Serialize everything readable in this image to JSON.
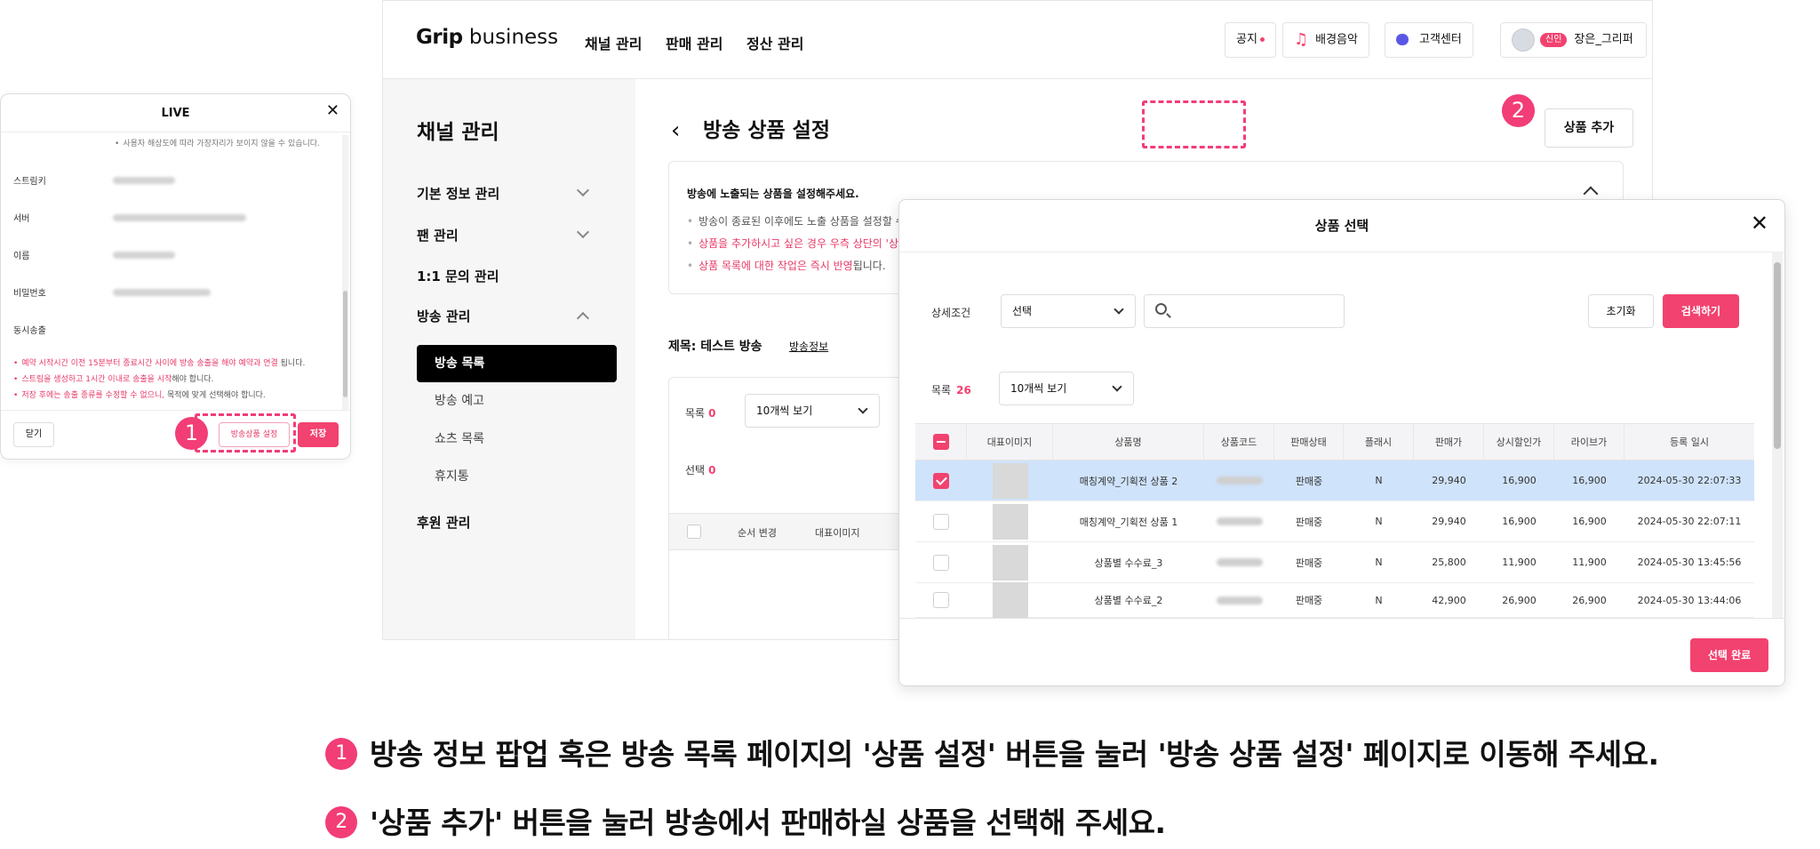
{
  "live_popup": {
    "title": "LIVE",
    "note": "사용자 해상도에 따라 가장자리가 보이지 않을 수 있습니다.",
    "rows": [
      "스트림키",
      "서버",
      "이름",
      "비밀번호",
      "동시송출"
    ],
    "warnings": [
      {
        "pink": "예약 시작시간 이전 15분부터 종료시간 사이에 방송 송출을 해야 예약과 연결",
        "rest": " 됩니다."
      },
      {
        "pink": "스트림을 생성하고 1시간 이내로 송출을 시작",
        "rest": "해야 합니다."
      },
      {
        "pink": "저장 후에는 송출 종류를 수정할 수 없으니,",
        "rest": " 목적에 맞게 선택해야 합니다."
      }
    ],
    "close_label": "닫기",
    "product_setting_label": "방송상품 설정",
    "save_label": "저장"
  },
  "badges": {
    "one": "1",
    "two": "2"
  },
  "header": {
    "logo_bold": "Grip",
    "logo_rest": " business",
    "nav": [
      "채널 관리",
      "판매 관리",
      "정산 관리"
    ],
    "notice": "공지",
    "music": "배경음악",
    "support": "고객센터",
    "new_badge": "신인",
    "username": "장은_그리퍼"
  },
  "sidebar": {
    "title": "채널 관리",
    "items": [
      "기본 정보 관리",
      "팬 관리",
      "1:1 문의 관리",
      "방송 관리",
      "후원 관리"
    ],
    "subitems": [
      "방송 목록",
      "방송 예고",
      "쇼츠 목록",
      "휴지통"
    ]
  },
  "page": {
    "back": "‹",
    "title": "방송 상품 설정",
    "add_button": "상품 추가",
    "info_heading": "방송에 노출되는 상품을 설정해주세요.",
    "info_1": "방송이 종료된 이후에도 노출 상품을 설정할 수",
    "info_2": "상품을 추가하시고 싶은 경우 우측 상단의 '상",
    "info_3_pink": "상품 목록에 대한 작업은 즉시 반영",
    "info_3_rest": "됩니다.",
    "subject": "제목: 테스트 방송",
    "subject_link": "방송정보",
    "list_label": "목록",
    "list_count": "0",
    "select_label": "선택",
    "select_count": "0",
    "per_page": "10개씩 보기",
    "col_order": "순서 변경",
    "col_image": "대표이미지"
  },
  "modal": {
    "title": "상품 선택",
    "detail_label": "상세조건",
    "detail_value": "선택",
    "reset": "초기화",
    "search": "검색하기",
    "list_label": "목록",
    "list_count": "26",
    "per_page": "10개씩 보기",
    "columns": [
      "대표이미지",
      "상품명",
      "상품코드",
      "판매상태",
      "플래시",
      "판매가",
      "상시할인가",
      "라이브가",
      "등록 일시"
    ],
    "rows": [
      {
        "name": "매칭계약_기획전 상품 2",
        "status": "판매중",
        "flash": "N",
        "price": "29,940",
        "discount": "16,900",
        "live": "16,900",
        "date": "2024-05-30 22:07:33",
        "checked": true
      },
      {
        "name": "매칭계약_기획전 상품 1",
        "status": "판매중",
        "flash": "N",
        "price": "29,940",
        "discount": "16,900",
        "live": "16,900",
        "date": "2024-05-30 22:07:11",
        "checked": false
      },
      {
        "name": "상품별 수수료_3",
        "status": "판매중",
        "flash": "N",
        "price": "25,800",
        "discount": "11,900",
        "live": "11,900",
        "date": "2024-05-30 13:45:56",
        "checked": false
      },
      {
        "name": "상품별 수수료_2",
        "status": "판매중",
        "flash": "N",
        "price": "42,900",
        "discount": "26,900",
        "live": "26,900",
        "date": "2024-05-30 13:44:06",
        "checked": false
      }
    ],
    "done": "선택 완료"
  },
  "instructions": [
    "방송 정보 팝업 혹은 방송 목록 페이지의 '상품 설정' 버튼을 눌러 '방송 상품 설정' 페이지로 이동해 주세요.",
    "'상품 추가' 버튼을 눌러 방송에서 판매하실 상품을 선택해 주세요."
  ],
  "colors": {
    "accent": "#f2426f",
    "dash": "#f23d77",
    "selected_row": "#cfe3fb"
  }
}
